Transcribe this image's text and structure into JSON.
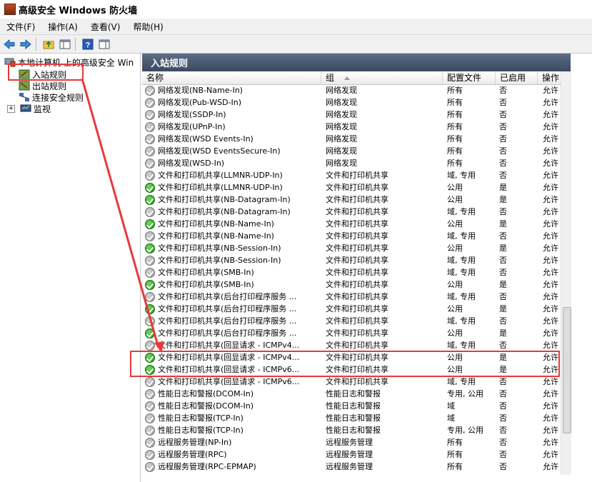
{
  "window": {
    "title": "高级安全 Windows 防火墙"
  },
  "menu": [
    "文件(F)",
    "操作(A)",
    "查看(V)",
    "帮助(H)"
  ],
  "toolbar": [
    "back-icon",
    "forward-icon",
    "up-folder-icon",
    "show-hide-tree-icon",
    "help-icon",
    "properties-pane-icon"
  ],
  "tree": {
    "root": "本地计算机 上的高级安全 Win",
    "items": [
      "入站规则",
      "出站规则",
      "连接安全规则",
      "监视"
    ],
    "expand": "+"
  },
  "pane": {
    "title": "入站规则",
    "columns": [
      "名称",
      "组",
      "配置文件",
      "已启用",
      "操作"
    ]
  },
  "rows": [
    {
      "name": "网络发现(NB-Name-In)",
      "group": "网络发现",
      "profile": "所有",
      "enabled": "否",
      "action": "允许",
      "on": false
    },
    {
      "name": "网络发现(Pub-WSD-In)",
      "group": "网络发现",
      "profile": "所有",
      "enabled": "否",
      "action": "允许",
      "on": false
    },
    {
      "name": "网络发现(SSDP-In)",
      "group": "网络发现",
      "profile": "所有",
      "enabled": "否",
      "action": "允许",
      "on": false
    },
    {
      "name": "网络发现(UPnP-In)",
      "group": "网络发现",
      "profile": "所有",
      "enabled": "否",
      "action": "允许",
      "on": false
    },
    {
      "name": "网络发现(WSD Events-In)",
      "group": "网络发现",
      "profile": "所有",
      "enabled": "否",
      "action": "允许",
      "on": false
    },
    {
      "name": "网络发现(WSD EventsSecure-In)",
      "group": "网络发现",
      "profile": "所有",
      "enabled": "否",
      "action": "允许",
      "on": false
    },
    {
      "name": "网络发现(WSD-In)",
      "group": "网络发现",
      "profile": "所有",
      "enabled": "否",
      "action": "允许",
      "on": false
    },
    {
      "name": "文件和打印机共享(LLMNR-UDP-In)",
      "group": "文件和打印机共享",
      "profile": "域, 专用",
      "enabled": "否",
      "action": "允许",
      "on": false
    },
    {
      "name": "文件和打印机共享(LLMNR-UDP-In)",
      "group": "文件和打印机共享",
      "profile": "公用",
      "enabled": "是",
      "action": "允许",
      "on": true
    },
    {
      "name": "文件和打印机共享(NB-Datagram-In)",
      "group": "文件和打印机共享",
      "profile": "公用",
      "enabled": "是",
      "action": "允许",
      "on": true
    },
    {
      "name": "文件和打印机共享(NB-Datagram-In)",
      "group": "文件和打印机共享",
      "profile": "域, 专用",
      "enabled": "否",
      "action": "允许",
      "on": false
    },
    {
      "name": "文件和打印机共享(NB-Name-In)",
      "group": "文件和打印机共享",
      "profile": "公用",
      "enabled": "是",
      "action": "允许",
      "on": true
    },
    {
      "name": "文件和打印机共享(NB-Name-In)",
      "group": "文件和打印机共享",
      "profile": "域, 专用",
      "enabled": "否",
      "action": "允许",
      "on": false
    },
    {
      "name": "文件和打印机共享(NB-Session-In)",
      "group": "文件和打印机共享",
      "profile": "公用",
      "enabled": "是",
      "action": "允许",
      "on": true
    },
    {
      "name": "文件和打印机共享(NB-Session-In)",
      "group": "文件和打印机共享",
      "profile": "域, 专用",
      "enabled": "否",
      "action": "允许",
      "on": false
    },
    {
      "name": "文件和打印机共享(SMB-In)",
      "group": "文件和打印机共享",
      "profile": "域, 专用",
      "enabled": "否",
      "action": "允许",
      "on": false
    },
    {
      "name": "文件和打印机共享(SMB-In)",
      "group": "文件和打印机共享",
      "profile": "公用",
      "enabled": "是",
      "action": "允许",
      "on": true
    },
    {
      "name": "文件和打印机共享(后台打印程序服务 ...",
      "group": "文件和打印机共享",
      "profile": "域, 专用",
      "enabled": "否",
      "action": "允许",
      "on": false
    },
    {
      "name": "文件和打印机共享(后台打印程序服务 ...",
      "group": "文件和打印机共享",
      "profile": "公用",
      "enabled": "是",
      "action": "允许",
      "on": true
    },
    {
      "name": "文件和打印机共享(后台打印程序服务 ...",
      "group": "文件和打印机共享",
      "profile": "域, 专用",
      "enabled": "否",
      "action": "允许",
      "on": false
    },
    {
      "name": "文件和打印机共享(后台打印程序服务 ...",
      "group": "文件和打印机共享",
      "profile": "公用",
      "enabled": "是",
      "action": "允许",
      "on": true
    },
    {
      "name": "文件和打印机共享(回显请求 - ICMPv4...",
      "group": "文件和打印机共享",
      "profile": "域, 专用",
      "enabled": "否",
      "action": "允许",
      "on": false
    },
    {
      "name": "文件和打印机共享(回显请求 - ICMPv4...",
      "group": "文件和打印机共享",
      "profile": "公用",
      "enabled": "是",
      "action": "允许",
      "on": true
    },
    {
      "name": "文件和打印机共享(回显请求 - ICMPv6...",
      "group": "文件和打印机共享",
      "profile": "公用",
      "enabled": "是",
      "action": "允许",
      "on": true
    },
    {
      "name": "文件和打印机共享(回显请求 - ICMPv6...",
      "group": "文件和打印机共享",
      "profile": "域, 专用",
      "enabled": "否",
      "action": "允许",
      "on": false
    },
    {
      "name": "性能日志和警报(DCOM-In)",
      "group": "性能日志和警报",
      "profile": "专用, 公用",
      "enabled": "否",
      "action": "允许",
      "on": false
    },
    {
      "name": "性能日志和警报(DCOM-In)",
      "group": "性能日志和警报",
      "profile": "域",
      "enabled": "否",
      "action": "允许",
      "on": false
    },
    {
      "name": "性能日志和警报(TCP-In)",
      "group": "性能日志和警报",
      "profile": "域",
      "enabled": "否",
      "action": "允许",
      "on": false
    },
    {
      "name": "性能日志和警报(TCP-In)",
      "group": "性能日志和警报",
      "profile": "专用, 公用",
      "enabled": "否",
      "action": "允许",
      "on": false
    },
    {
      "name": "远程服务管理(NP-In)",
      "group": "远程服务管理",
      "profile": "所有",
      "enabled": "否",
      "action": "允许",
      "on": false
    },
    {
      "name": "远程服务管理(RPC)",
      "group": "远程服务管理",
      "profile": "所有",
      "enabled": "否",
      "action": "允许",
      "on": false
    },
    {
      "name": "远程服务管理(RPC-EPMAP)",
      "group": "远程服务管理",
      "profile": "所有",
      "enabled": "否",
      "action": "允许",
      "on": false
    }
  ]
}
